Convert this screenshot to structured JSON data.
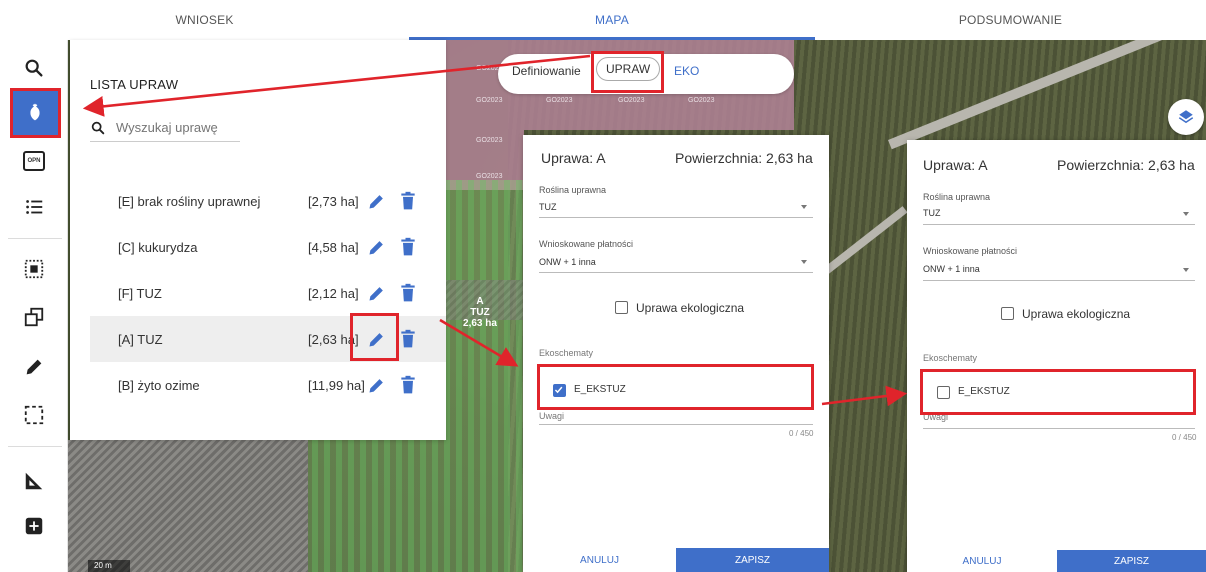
{
  "tabs": {
    "wniosek": "WNIOSEK",
    "mapa": "MAPA",
    "podsumowanie": "PODSUMOWANIE"
  },
  "accent": "#3f6fc9",
  "highlight_color": "#e0242b",
  "toolbar": {
    "items": [
      "search-icon",
      "crop-icon",
      "opn-icon",
      "list-icon",
      "select-area-icon",
      "copy-icon",
      "pencil-icon",
      "selection-icon",
      "measure-icon",
      "add-icon"
    ],
    "opn_label": "OPN"
  },
  "list": {
    "title": "LISTA UPRAW",
    "search_placeholder": "Wyszukaj uprawę",
    "rows": [
      {
        "name": "[E] brak rośliny uprawnej",
        "area": "[2,73 ha]"
      },
      {
        "name": "[C] kukurydza",
        "area": "[4,58 ha]"
      },
      {
        "name": "[F] TUZ",
        "area": "[2,12 ha]"
      },
      {
        "name": "[A] TUZ",
        "area": "[2,63 ha]"
      },
      {
        "name": "[B] żyto ozime",
        "area": "[11,99 ha]"
      }
    ]
  },
  "toggle": {
    "left": "Definiowanie",
    "middle": "UPRAW",
    "right": "EKO"
  },
  "map": {
    "go_tag": "GO2023",
    "field_label": "A",
    "field_label2": "TUZ",
    "field_label3": "2,63 ha",
    "scale": "20 m"
  },
  "form_left": {
    "title": "Uprawa: A",
    "area": "Powierzchnia: 2,63 ha",
    "crop_label": "Roślina uprawna",
    "crop_value": "TUZ",
    "payments_label": "Wnioskowane płatności",
    "payments_value": "ONW + 1 inna",
    "eco_label": "Uprawa ekologiczna",
    "ecoschemes_label": "Ekoschematy",
    "ecoscheme": "E_EKSTUZ",
    "ecoscheme_checked": true,
    "notes_label": "Uwagi",
    "counter": "0 / 450",
    "cancel": "ANULUJ",
    "save": "ZAPISZ"
  },
  "form_right": {
    "title": "Uprawa: A",
    "area": "Powierzchnia: 2,63 ha",
    "crop_label": "Roślina uprawna",
    "crop_value": "TUZ",
    "payments_label": "Wnioskowane płatności",
    "payments_value": "ONW + 1 inna",
    "eco_label": "Uprawa ekologiczna",
    "ecoschemes_label": "Ekoschematy",
    "ecoscheme": "E_EKSTUZ",
    "ecoscheme_checked": false,
    "notes_label": "Uwagi",
    "counter": "0 / 450",
    "cancel": "ANULUJ",
    "save": "ZAPISZ"
  }
}
